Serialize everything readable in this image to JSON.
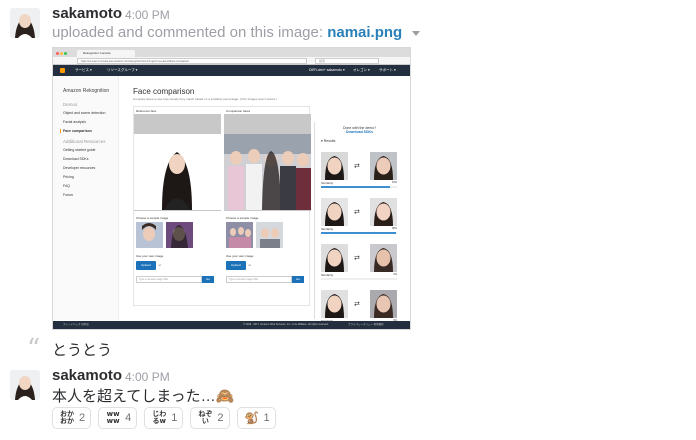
{
  "message1": {
    "username": "sakamoto",
    "timestamp": "4:00 PM",
    "action_text": "uploaded and commented on this image:",
    "filename": "namai.png"
  },
  "screenshot": {
    "tab_title": "Rekognition Console",
    "url": "https://us-east-1.console.aws.amazon.com/rekognition/home?region=us-east-1#/face-comparison",
    "search_placeholder": "検索",
    "aws_nav": {
      "services": "サービス ▾",
      "resource_groups": "リソースグループ ▾",
      "account": "DIRY-dev+ sakamoto ▾",
      "region": "オレゴン ▾",
      "support": "サポート ▾"
    },
    "sidebar": {
      "title": "Amazon Rekognition",
      "demos_header": "Demos",
      "demos": [
        "Object and scene detection",
        "Facial analysis",
        "Face comparison"
      ],
      "resources_header": "Additional Resources",
      "resources": [
        "Getting started guide",
        "Download SDKs",
        "Developer resources",
        "Pricing",
        "FAQ",
        "Forum"
      ]
    },
    "page_title": "Face comparison",
    "page_subtitle": "Compare faces to see how closely they match based on a similarity percentage. (Your images aren't stored.)",
    "reference_label": "Reference face",
    "comparison_label": "Comparison faces",
    "choose_sample": "Choose a sample image",
    "use_own": "Use your own image",
    "upload_btn": "Upload",
    "or_text": "or",
    "url_placeholder": "Type a remote image URL",
    "go_btn": "Go",
    "done_text": "Done with the demo?",
    "download_sdks": "Download SDKs",
    "results_header": "▾ Results",
    "similarity_label": "Similarity",
    "results": [
      {
        "percent": "91%",
        "fill": 0.91
      },
      {
        "percent": "99%",
        "fill": 0.99
      },
      {
        "percent": "0%",
        "fill": 0.0
      },
      {
        "percent": "0%",
        "fill": 0.0
      }
    ],
    "footer_left": "フィードバック  日本語",
    "footer_center": "© 2008 - 2017, Amazon Web Services, Inc. or its affiliates. All rights reserved.",
    "footer_right": "プライバシーポリシー  利用規約"
  },
  "quote": {
    "text": "とうとう"
  },
  "message2": {
    "username": "sakamoto",
    "timestamp": "4:00 PM",
    "text": "本人を超えてしまった…🙈"
  },
  "reactions": [
    {
      "emoji": "おか\nおか",
      "count": "2"
    },
    {
      "emoji": "ww\nww",
      "count": "4"
    },
    {
      "emoji": "じわ\nるw",
      "count": "1"
    },
    {
      "emoji": "ねぞ\nい",
      "count": "2"
    },
    {
      "emoji": "🐒",
      "count": "1"
    }
  ]
}
